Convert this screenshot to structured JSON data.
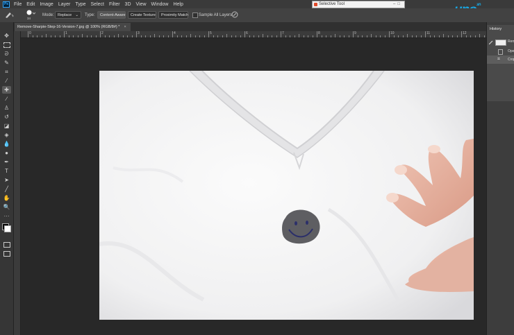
{
  "app": {
    "logo_letters": "Ps"
  },
  "menu": [
    "File",
    "Edit",
    "Image",
    "Layer",
    "Type",
    "Select",
    "Filter",
    "3D",
    "View",
    "Window",
    "Help"
  ],
  "options_bar": {
    "brush_size": "34",
    "mode_label": "Mode:",
    "mode_value": "Replace",
    "type_label": "Type:",
    "type_buttons": [
      "Content-Aware",
      "Create Texture",
      "Proximity Match"
    ],
    "sample_all_layers_label": "Sample All Layers"
  },
  "popup": {
    "title": "Selective Tool"
  },
  "document": {
    "tab_title": "Remove-Sharpie-Step-16-Version-7.jpg @ 100% (RGB/8#) *",
    "close_glyph": "×"
  },
  "ruler": {
    "labels": [
      "0",
      "1",
      "2",
      "3",
      "4",
      "5",
      "6",
      "7",
      "8",
      "9",
      "10",
      "11",
      "12",
      "13"
    ]
  },
  "history": {
    "title": "History",
    "items": [
      "Rem",
      "Open",
      "Crop"
    ]
  },
  "watermark": {
    "text": "uno",
    "suffix": ".vn"
  },
  "colors": {
    "foreground": "#000000",
    "background": "#ffffff",
    "accent": "#31a8ff"
  }
}
